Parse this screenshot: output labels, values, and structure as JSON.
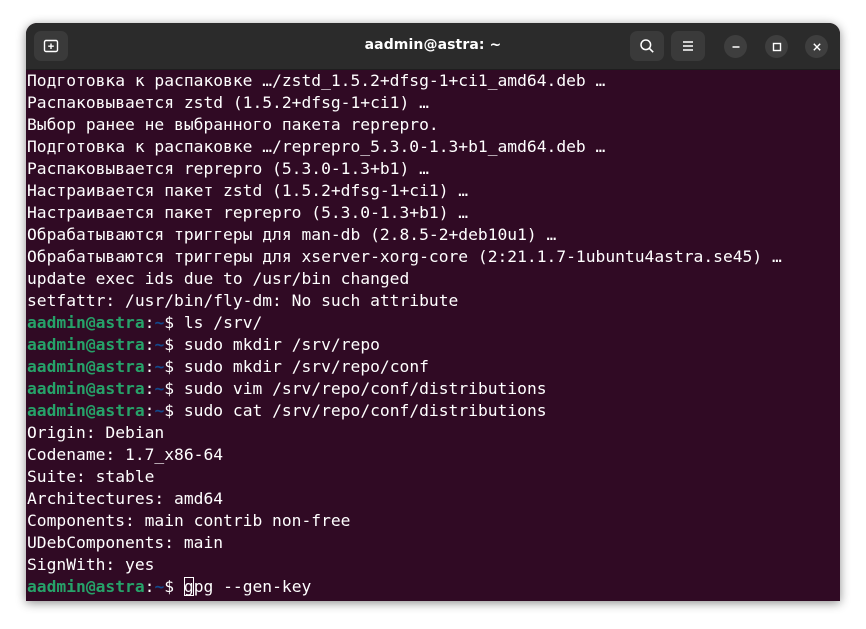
{
  "window": {
    "title": "aadmin@astra: ~"
  },
  "icons": {
    "new_tab": "new-tab-icon",
    "search": "search-icon",
    "menu": "hamburger-menu-icon",
    "minimize": "minimize-icon",
    "maximize": "maximize-icon",
    "close": "close-icon"
  },
  "prompt": {
    "user_host": "aadmin@astra",
    "colon": ":",
    "path": "~",
    "dollar": "$ "
  },
  "output_lines": [
    "Подготовка к распаковке …/zstd_1.5.2+dfsg-1+ci1_amd64.deb …",
    "Распаковывается zstd (1.5.2+dfsg-1+ci1) …",
    "Выбор ранее не выбранного пакета reprepro.",
    "Подготовка к распаковке …/reprepro_5.3.0-1.3+b1_amd64.deb …",
    "Распаковывается reprepro (5.3.0-1.3+b1) …",
    "Настраивается пакет zstd (1.5.2+dfsg-1+ci1) …",
    "Настраивается пакет reprepro (5.3.0-1.3+b1) …",
    "Обрабатываются триггеры для man-db (2.8.5-2+deb10u1) …",
    "Обрабатываются триггеры для xserver-xorg-core (2:21.1.7-1ubuntu4astra.se45) …",
    "update exec ids due to /usr/bin changed",
    "setfattr: /usr/bin/fly-dm: No such attribute"
  ],
  "commands": [
    "ls /srv/",
    "sudo mkdir /srv/repo",
    "sudo mkdir /srv/repo/conf",
    "sudo vim /srv/repo/conf/distributions",
    "sudo cat /srv/repo/conf/distributions"
  ],
  "file_lines": [
    "Origin: Debian",
    "Codename: 1.7_x86-64",
    "Suite: stable",
    "Architectures: amd64",
    "Components: main contrib non-free",
    "UDebComponents: main",
    "SignWith: yes"
  ],
  "current_input": {
    "cursor_char": "g",
    "rest": "pg --gen-key"
  },
  "colors": {
    "background": "#300a24",
    "prompt_user": "#26a269",
    "prompt_path": "#12488b",
    "titlebar": "#2b2b2b"
  }
}
